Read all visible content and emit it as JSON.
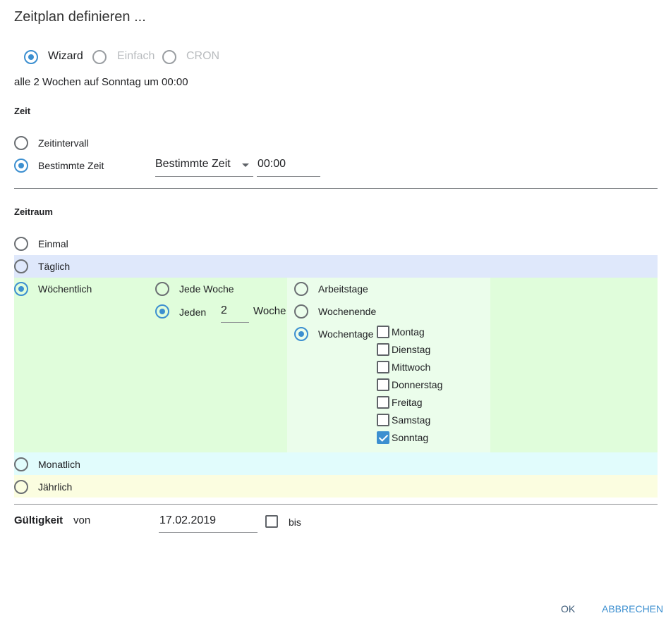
{
  "dialog": {
    "title": "Zeitplan definieren ..."
  },
  "mode": {
    "options": [
      "Wizard",
      "Einfach",
      "CRON"
    ],
    "selected": "Wizard"
  },
  "summary": "alle 2 Wochen auf Sonntag um 00:00",
  "zeit": {
    "heading": "Zeit",
    "option_interval": "Zeitintervall",
    "option_specific": "Bestimmte Zeit",
    "selected": "Bestimmte Zeit",
    "dropdown_value": "Bestimmte Zeit",
    "time_value": "00:00"
  },
  "zeitraum": {
    "heading": "Zeitraum",
    "options": {
      "einmal": "Einmal",
      "taeglich": "Täglich",
      "woechentlich": "Wöchentlich",
      "monatlich": "Monatlich",
      "jaehrlich": "Jährlich"
    },
    "selected": "Wöchentlich",
    "weekly": {
      "jede_woche": "Jede Woche",
      "jeden": "Jeden",
      "interval_value": "2",
      "woche_label": "Woche",
      "selected_freq": "Jeden",
      "day_mode": {
        "arbeitstage": "Arbeitstage",
        "wochenende": "Wochenende",
        "wochentage": "Wochentage",
        "selected": "Wochentage"
      },
      "days": [
        {
          "label": "Montag",
          "checked": false
        },
        {
          "label": "Dienstag",
          "checked": false
        },
        {
          "label": "Mittwoch",
          "checked": false
        },
        {
          "label": "Donnerstag",
          "checked": false
        },
        {
          "label": "Freitag",
          "checked": false
        },
        {
          "label": "Samstag",
          "checked": false
        },
        {
          "label": "Sonntag",
          "checked": true
        }
      ]
    }
  },
  "validity": {
    "heading": "Gültigkeit",
    "from_label": "von",
    "from_value": "17.02.2019",
    "to_label": "bis",
    "to_checked": false
  },
  "buttons": {
    "ok": "OK",
    "cancel": "ABBRECHEN"
  },
  "colors": {
    "accent": "#3c8fd0",
    "taeglich_bg": "#dfe8fb",
    "woechentlich_bg": "#e0fddb",
    "woechentlich_inner_bg": "#ebfdeb",
    "monatlich_bg": "#e1fcfc",
    "jaehrlich_bg": "#fbfde0"
  }
}
